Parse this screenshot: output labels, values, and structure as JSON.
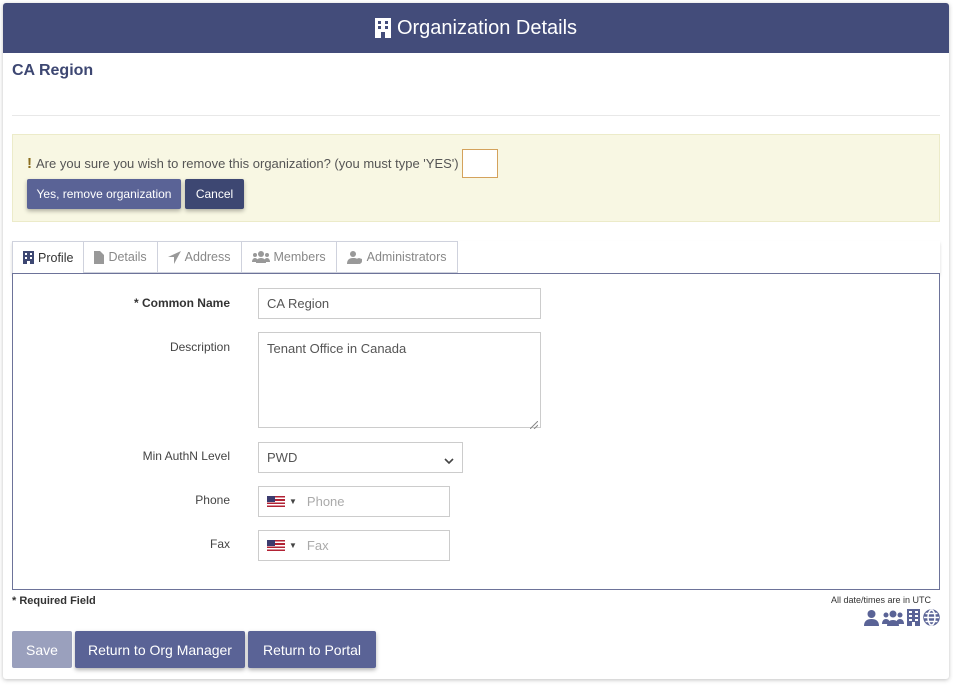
{
  "header": {
    "title": "Organization Details",
    "icon": "building-icon"
  },
  "org": {
    "name": "CA Region"
  },
  "alert": {
    "message": "Are you sure you wish to remove this organization? (you must type 'YES')",
    "confirm_value": "",
    "remove_label": "Yes, remove organization",
    "cancel_label": "Cancel"
  },
  "tabs": [
    {
      "label": "Profile",
      "icon": "building-icon",
      "active": true
    },
    {
      "label": "Details",
      "icon": "document-icon",
      "active": false
    },
    {
      "label": "Address",
      "icon": "location-arrow-icon",
      "active": false
    },
    {
      "label": "Members",
      "icon": "users-icon",
      "active": false
    },
    {
      "label": "Administrators",
      "icon": "user-shield-icon",
      "active": false
    }
  ],
  "form": {
    "common_name_label": "* Common Name",
    "common_name_value": "CA Region",
    "description_label": "Description",
    "description_value": "Tenant Office in Canada",
    "authn_label": "Min AuthN Level",
    "authn_value": "PWD",
    "phone_label": "Phone",
    "phone_placeholder": "Phone",
    "fax_label": "Fax",
    "fax_placeholder": "Fax"
  },
  "footer": {
    "required_note": "* Required Field",
    "utc_note": "All date/times are in UTC",
    "save_label": "Save",
    "org_manager_label": "Return to Org Manager",
    "portal_label": "Return to Portal"
  },
  "colors": {
    "primary": "#434c7a",
    "button": "#5a6396",
    "alert_bg": "#f8f7e3"
  }
}
